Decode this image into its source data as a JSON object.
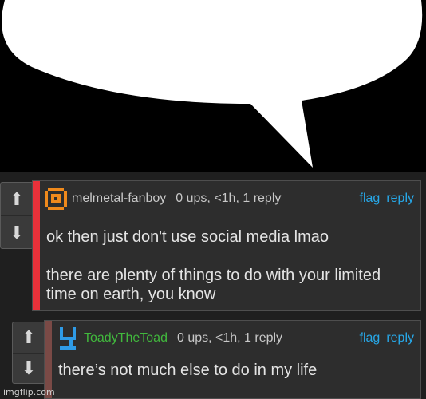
{
  "comments": [
    {
      "username": "melmetal-fanboy",
      "meta": "0 ups, <1h, 1 reply",
      "flag": "flag",
      "reply": "reply",
      "body": [
        "ok then just don't use social media lmao",
        "there are plenty of things to do with your limited time on earth, you know"
      ],
      "accent_color": "#e8313a",
      "username_color": "#c9c9c9"
    },
    {
      "username": "ToadyTheToad",
      "meta": "0 ups, <1h, 1 reply",
      "flag": "flag",
      "reply": "reply",
      "body": [
        "there’s not much else to do in my life"
      ],
      "accent_color": "#7a4a46",
      "username_color": "#41b93d"
    }
  ],
  "icons": {
    "upvote": "arrow-up-icon",
    "downvote": "arrow-down-icon",
    "avatar1": "orange-pixel-avatar-icon",
    "avatar2": "blue-pixel-avatar-icon"
  },
  "watermark": "imgflip.com",
  "colors": {
    "link": "#27a8e8",
    "panel": "#2d2d2d",
    "background": "#1f1f1f"
  }
}
